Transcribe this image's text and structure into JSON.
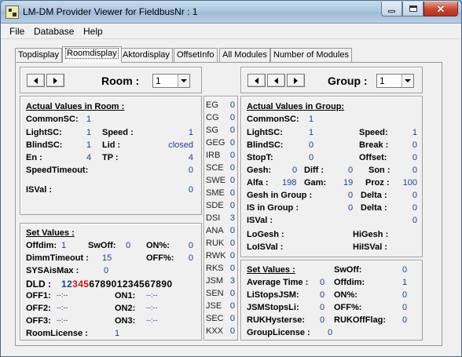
{
  "window": {
    "title": "LM-DM Provider Viewer for FieldbusNr : 1"
  },
  "menu": {
    "file": "File",
    "database": "Database",
    "help": "Help"
  },
  "tabs": [
    "Topdisplay",
    "Roomdisplay",
    "Aktordisplay",
    "OffsetInfo",
    "All Modules",
    "Number of Modules"
  ],
  "room_nav": {
    "label": "Room :",
    "value": "1"
  },
  "group_nav": {
    "label": "Group :",
    "value": "1"
  },
  "room_actual": {
    "title": "Actual Values in Room :",
    "common_sc_label": "CommonSC:",
    "common_sc": "1",
    "light_sc_label": "LightSC:",
    "light_sc": "1",
    "speed_label": "Speed :",
    "speed": "1",
    "blind_sc_label": "BlindSC:",
    "blind_sc": "1",
    "lid_label": "Lid :",
    "lid": "closed",
    "en_label": "En :",
    "en": "4",
    "tp_label": "TP :",
    "tp": "4",
    "speed_timeout_label": "SpeedTimeout:",
    "speed_timeout": "0",
    "isval_label": "ISVal :",
    "isval": "0"
  },
  "room_set": {
    "title": "Set Values :",
    "offdim_label": "Offdim:",
    "offdim": "1",
    "swoff_label": "SwOff:",
    "swoff": "0",
    "on_pct_label": "ON%:",
    "on_pct": "0",
    "dimm_timeout_label": "DimmTimeout :",
    "dimm_timeout": "15",
    "off_pct_label": "OFF%:",
    "off_pct": "0",
    "sysaismax_label": "SYSAisMax :",
    "sysaismax": "0",
    "dld_label": "DLD :",
    "dld_a": "12",
    "dld_b": "345",
    "dld_c": "67890",
    "dld_d": "1234567890",
    "off1_label": "OFF1:",
    "off1": "--:--",
    "on1_label": "ON1:",
    "on1": "--:--",
    "off2_label": "OFF2:",
    "off2": "--:--",
    "on2_label": "ON2:",
    "on2": "--:--",
    "off3_label": "OFF3:",
    "off3": "--:--",
    "on3_label": "ON3:",
    "on3": "--:--",
    "room_license_label": "RoomLicense :",
    "room_license": "1"
  },
  "codes": [
    {
      "name": "EG",
      "value": "0"
    },
    {
      "name": "CG",
      "value": "0"
    },
    {
      "name": "SG",
      "value": "0"
    },
    {
      "name": "GEG",
      "value": "0"
    },
    {
      "name": "IRB",
      "value": "0"
    },
    {
      "name": "SCE",
      "value": "0"
    },
    {
      "name": "SWE",
      "value": "0"
    },
    {
      "name": "SME",
      "value": "0"
    },
    {
      "name": "SDE",
      "value": "0"
    },
    {
      "name": "DSI",
      "value": "3"
    },
    {
      "name": "ANA",
      "value": "0"
    },
    {
      "name": "RUK",
      "value": "0"
    },
    {
      "name": "RWK",
      "value": "0"
    },
    {
      "name": "RKS",
      "value": "0"
    },
    {
      "name": "JSM",
      "value": "3"
    },
    {
      "name": "SEN",
      "value": "0"
    },
    {
      "name": "JSE",
      "value": "0"
    },
    {
      "name": "SEC",
      "value": "0"
    },
    {
      "name": "KXX",
      "value": "0"
    }
  ],
  "group_actual": {
    "title": "Actual Values in Group:",
    "common_sc_label": "CommonSC:",
    "common_sc": "1",
    "light_sc_label": "LightSC:",
    "light_sc": "1",
    "speed_label": "Speed:",
    "speed": "1",
    "blind_sc_label": "BlindSC:",
    "blind_sc": "0",
    "break_label": "Break :",
    "break_val": "0",
    "stopt_label": "StopT:",
    "stopt": "0",
    "offset_label": "Offset:",
    "offset": "0",
    "gesh_label": "Gesh:",
    "gesh": "0",
    "diff_label": "Diff :",
    "diff": "0",
    "son_label": "Son :",
    "son": "0",
    "alfa_label": "Alfa :",
    "alfa": "198",
    "gam_label": "Gam:",
    "gam": "19",
    "proz_label": "Proz :",
    "proz": "100",
    "gesh_in_group_label": "Gesh in Group :",
    "gesh_in_group": "0",
    "delta1_label": "Delta :",
    "delta1": "0",
    "is_in_group_label": "IS in Group :",
    "is_in_group": "0",
    "delta2_label": "Delta :",
    "delta2": "0",
    "isval_label": "ISVal :",
    "isval": "0",
    "logesh_label": "LoGesh :",
    "higesh_label": "HiGesh :",
    "loisval_label": "LoISVal :",
    "hiisval_label": "HiISVal :"
  },
  "group_set": {
    "title": "Set Values :",
    "swoff_label": "SwOff:",
    "swoff": "0",
    "avg_time_label": "Average Time :",
    "avg_time": "0",
    "offdim_label": "Offdim:",
    "offdim": "1",
    "listops_label": "LiStopsJSM:",
    "listops": "0",
    "on_pct_label": "ON%:",
    "on_pct": "0",
    "jsmstops_label": "JSMStopsLi:",
    "jsmstops": "0",
    "off_pct_label": "OFF%:",
    "off_pct": "0",
    "rukhyst_label": "RUKHysterse:",
    "rukhyst": "0",
    "rukoff_label": "RUKOffFlag:",
    "rukoff": "0",
    "group_license_label": "GroupLicense :",
    "group_license": "0"
  },
  "colors": {
    "value_blue": "#1c3f94",
    "dld_red": "#e01010",
    "title_blue": "#a9c4de",
    "close_red": "#c9452c"
  }
}
